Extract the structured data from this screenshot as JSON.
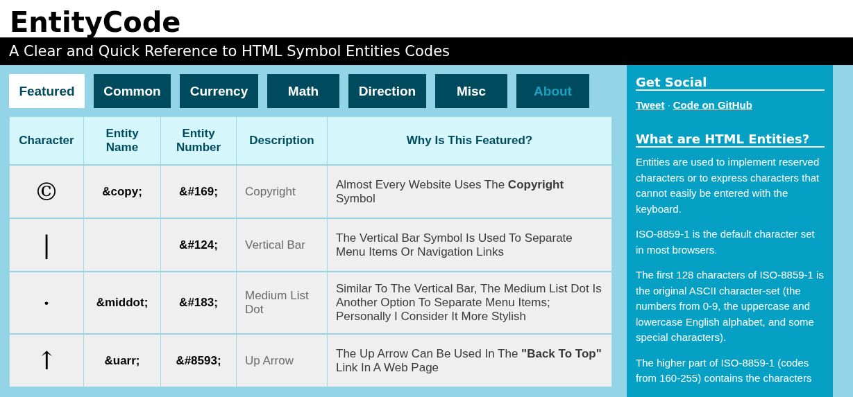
{
  "site": {
    "title": "EntityCode",
    "tagline": "A Clear and Quick Reference to HTML Symbol Entities Codes"
  },
  "tabs": [
    {
      "label": "Featured",
      "selected": true,
      "kind": "section"
    },
    {
      "label": "Common",
      "selected": false,
      "kind": "section"
    },
    {
      "label": "Currency",
      "selected": false,
      "kind": "section"
    },
    {
      "label": "Math",
      "selected": false,
      "kind": "section"
    },
    {
      "label": "Direction",
      "selected": false,
      "kind": "section"
    },
    {
      "label": "Misc",
      "selected": false,
      "kind": "section"
    },
    {
      "label": "About",
      "selected": false,
      "kind": "info"
    }
  ],
  "table": {
    "columns": [
      "Character",
      "Entity Name",
      "Entity Number",
      "Description",
      "Why Is This Featured?"
    ],
    "rows": [
      {
        "character": "©",
        "entity_name": "&copy;",
        "entity_number": "&#169;",
        "description": "Copyright",
        "reason": "Almost Every Website Uses The **Copyright** Symbol"
      },
      {
        "character": "|",
        "entity_number": "&#124;",
        "description": "Vertical Bar",
        "reason": "The Vertical Bar Symbol Is Used To Separate Menu Items Or Navigation Links"
      },
      {
        "character": "·",
        "entity_name": "&middot;",
        "entity_number": "&#183;",
        "description": "Medium List Dot",
        "reason": "Similar To The Vertical Bar, The Medium List Dot Is Another Option To Separate Menu Items; Personally I Consider It More Stylish"
      },
      {
        "character": "↑",
        "entity_name": "&uarr;",
        "entity_number": "&#8593;",
        "description": "Up Arrow",
        "reason": "The Up Arrow Can Be Used In The **\"Back To Top\"** Link In A Web Page"
      }
    ]
  },
  "sidebar": {
    "social_heading": "Get Social",
    "links": [
      "Tweet",
      "Code on GitHub"
    ],
    "separator": "·",
    "entities_heading": "What are HTML Entities?",
    "paragraphs": [
      "Entities are used to implement reserved characters or to express characters that cannot easily be entered with the keyboard.",
      "ISO-8859-1 is the default character set in most browsers.",
      "The first 128 characters of ISO-8859-1 is the original ASCII character-set (the numbers from 0-9, the uppercase and lowercase English alphabet, and some special characters).",
      "The higher part of ISO-8859-1 (codes from 160-255) contains the characters"
    ]
  }
}
